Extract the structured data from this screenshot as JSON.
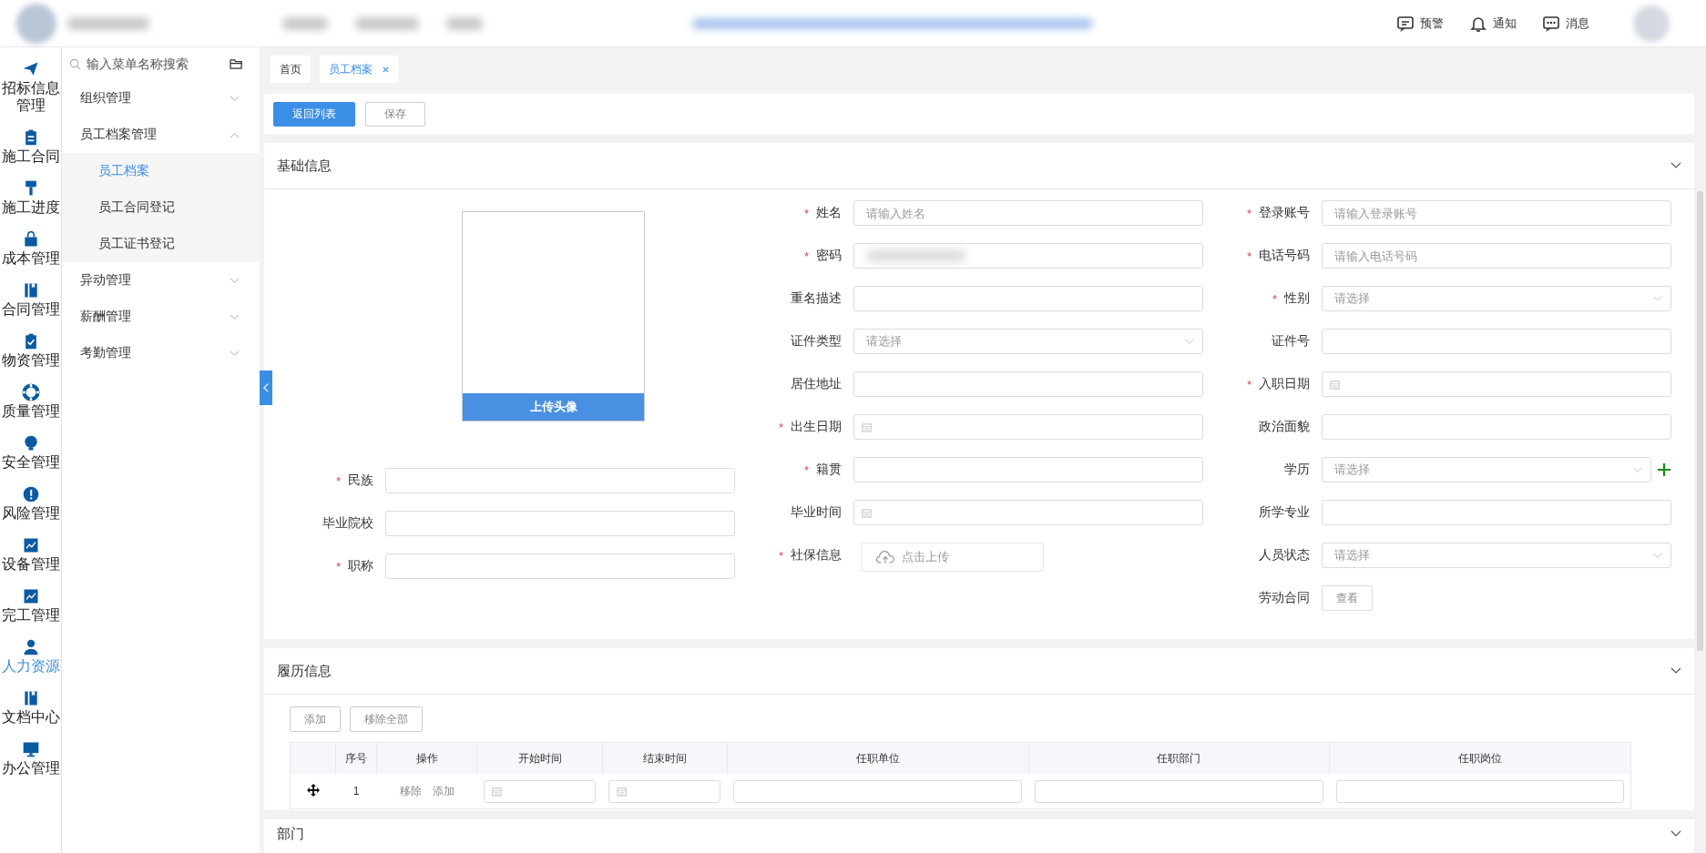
{
  "top_bar": {
    "actions": [
      {
        "label": "预警"
      },
      {
        "label": "通知"
      },
      {
        "label": "消息"
      }
    ]
  },
  "nav_rail": [
    {
      "label": "招标信息管理",
      "selected": false
    },
    {
      "label": "施工合同",
      "selected": false
    },
    {
      "label": "施工进度",
      "selected": false
    },
    {
      "label": "成本管理",
      "selected": false
    },
    {
      "label": "合同管理",
      "selected": false
    },
    {
      "label": "物资管理",
      "selected": false
    },
    {
      "label": "质量管理",
      "selected": false
    },
    {
      "label": "安全管理",
      "selected": false
    },
    {
      "label": "风险管理",
      "selected": false
    },
    {
      "label": "设备管理",
      "selected": false
    },
    {
      "label": "完工管理",
      "selected": false
    },
    {
      "label": "人力资源",
      "selected": true
    },
    {
      "label": "文档中心",
      "selected": false
    },
    {
      "label": "办公管理",
      "selected": false
    }
  ],
  "menu": {
    "search": {
      "placeholder": "输入菜单名称搜索"
    },
    "items": [
      {
        "label": "组织管理",
        "expanded": false
      },
      {
        "label": "员工档案管理",
        "expanded": true,
        "children": [
          {
            "label": "员工档案",
            "selected": true
          },
          {
            "label": "员工合同登记",
            "selected": false
          },
          {
            "label": "员工证书登记",
            "selected": false
          }
        ]
      },
      {
        "label": "异动管理",
        "expanded": false
      },
      {
        "label": "薪酬管理",
        "expanded": false
      },
      {
        "label": "考勤管理",
        "expanded": false
      }
    ]
  },
  "tabs": [
    {
      "label": "首页",
      "selected": false
    },
    {
      "label": "员工档案",
      "selected": true
    }
  ],
  "toolbar": [
    {
      "label": "返回列表",
      "kind": "primary"
    },
    {
      "label": "保存",
      "kind": "default"
    }
  ],
  "basic_info": {
    "title": "基础信息",
    "avatar": {
      "button": "上传头像"
    },
    "columns": [
      [
        {
          "label": "民族",
          "mark": "*",
          "kind": "text"
        },
        {
          "label": "毕业院校",
          "kind": "text"
        },
        {
          "label": "职称",
          "mark": "*",
          "kind": "text"
        }
      ],
      [
        {
          "label": "姓名",
          "mark": "*",
          "kind": "text",
          "placeholder": "请输入姓名"
        },
        {
          "label": "密码",
          "mark": "*",
          "kind": "password"
        },
        {
          "label": "重名描述",
          "kind": "text"
        },
        {
          "label": "证件类型",
          "kind": "select",
          "placeholder": "请选择"
        },
        {
          "label": "居住地址",
          "kind": "text"
        },
        {
          "label": "出生日期",
          "mark": "*",
          "kind": "date"
        },
        {
          "label": "籍贯",
          "mark": "*",
          "kind": "text"
        },
        {
          "label": "毕业时间",
          "kind": "date"
        },
        {
          "label": "社保信息",
          "mark": "*",
          "kind": "upload",
          "button": "点击上传"
        }
      ],
      [
        {
          "label": "登录账号",
          "mark": "*",
          "kind": "text",
          "placeholder": "请输入登录账号"
        },
        {
          "label": "电话号码",
          "mark": "*",
          "kind": "text",
          "placeholder": "请输入电话号码"
        },
        {
          "label": "性别",
          "mark": "*",
          "kind": "select",
          "placeholder": "请选择"
        },
        {
          "label": "证件号",
          "kind": "text"
        },
        {
          "label": "入职日期",
          "mark": "*",
          "kind": "date"
        },
        {
          "label": "政治面貌",
          "kind": "text"
        },
        {
          "label": "学历",
          "kind": "select_add",
          "placeholder": "请选择"
        },
        {
          "label": "所学专业",
          "kind": "text"
        },
        {
          "label": "人员状态",
          "kind": "select",
          "placeholder": "请选择"
        },
        {
          "label": "劳动合同",
          "kind": "view",
          "button": "查看"
        }
      ]
    ]
  },
  "resume": {
    "title": "履历信息",
    "buttons": [
      "添加",
      "移除全部"
    ],
    "table": {
      "columns": [
        {
          "label": "序号",
          "kind": "index"
        },
        {
          "label": "操作",
          "kind": "actions"
        },
        {
          "label": "开始时间",
          "kind": "date"
        },
        {
          "label": "结束时间",
          "kind": "date"
        },
        {
          "label": "任职单位",
          "kind": "text"
        },
        {
          "label": "任职部门",
          "kind": "text"
        },
        {
          "label": "任职岗位",
          "kind": "text"
        }
      ],
      "rows": [
        {
          "index": "1",
          "actions": [
            "移除",
            "添加"
          ]
        }
      ]
    }
  },
  "department": {
    "title": "部门"
  }
}
